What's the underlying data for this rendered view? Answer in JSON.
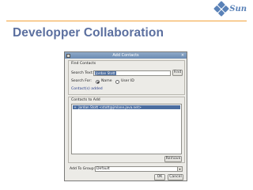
{
  "slide": {
    "brand": "Sun",
    "title": "Developper Collaboration"
  },
  "dialog": {
    "title": "Add Contacts",
    "close_glyph": "×",
    "find_section": {
      "label": "Find Contacts",
      "search_text_label": "Search Text:",
      "search_text_value": "Jordan Stott",
      "find_button": "Find",
      "search_for_label": "Search For:",
      "radio_options": [
        "Name",
        "User ID"
      ],
      "selected_option": "Name",
      "status": "Contact(s) added"
    },
    "contacts_section": {
      "label": "Contacts to Add",
      "items": [
        {
          "expander": "+",
          "text": "Jordan Stott <stott@jmlane.java.net>"
        }
      ],
      "remove_button": "Remove"
    },
    "add_to_group": {
      "label": "Add To Group:",
      "value": "Default"
    },
    "ok_button": "OK",
    "cancel_button": "Cancel"
  },
  "colors": {
    "title_blue": "#5b6f9f",
    "accent_orange": "#f2a23a",
    "selection_blue": "#4b6da0"
  }
}
